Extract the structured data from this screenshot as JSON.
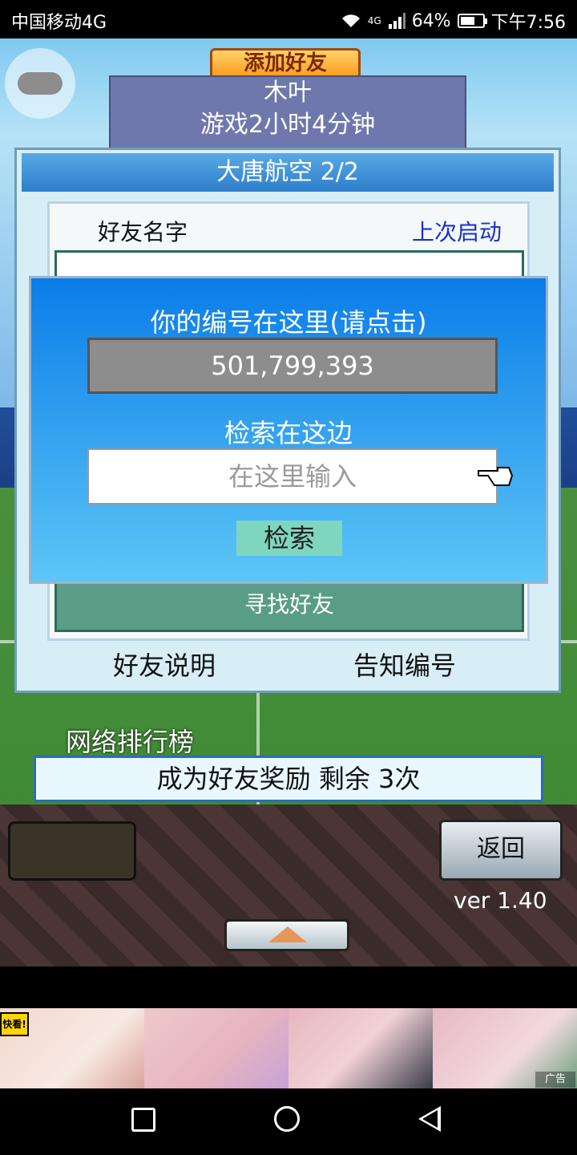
{
  "status_bar": {
    "carrier": "中国移动4G",
    "network": "4G",
    "battery_percent": "64%",
    "battery_level": 0.64,
    "time": "下午7:56"
  },
  "game": {
    "top_banner": "添加好友",
    "player_name": "木叶",
    "play_time": "游戏2小时4分钟",
    "window_title": "大唐航空 2/2",
    "columns": {
      "name": "好友名字",
      "last_launch": "上次启动"
    },
    "find_friend_button": "寻找好友",
    "tab_friend_help": "好友说明",
    "tab_notify_id": "告知编号",
    "ranking_label": "网络排行榜",
    "reward_text": "成为好友奖励 剩余 3次",
    "back_button": "返回",
    "version": "ver 1.40"
  },
  "modal": {
    "id_prompt": "你的编号在这里(请点击)",
    "id_value": "501,799,393",
    "search_prompt": "检索在这边",
    "search_placeholder": "在这里输入",
    "search_button": "检索"
  },
  "ad": {
    "logo_text": "快看!",
    "tag": "广告"
  },
  "colors": {
    "modal_top": "#0b7de8",
    "modal_bottom": "#5cc6f6",
    "link_blue": "#1a2fd3",
    "find_button": "#5a9d87"
  }
}
